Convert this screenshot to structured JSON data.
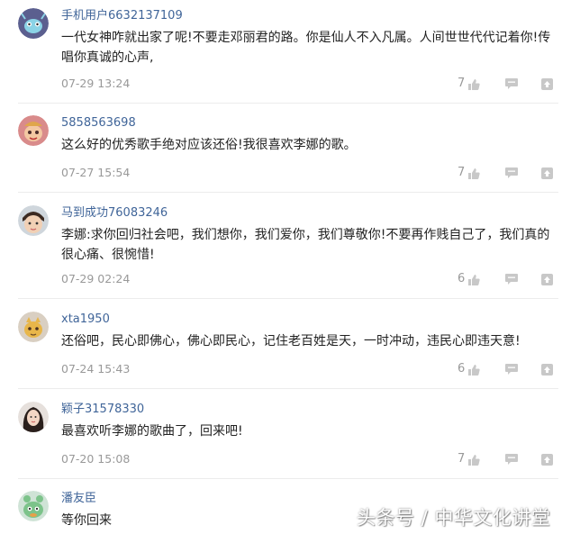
{
  "comments": [
    {
      "user": "手机用户6632137109",
      "text": "一代女神咋就出家了呢!不要走邓丽君的路。你是仙人不入凡属。人间世世代代记着你!传唱你真诚的心声,",
      "date": "07-29 13:24",
      "likes": "7",
      "avatar": "alien-avatar"
    },
    {
      "user": "5858563698",
      "text": "这么好的优秀歌手绝对应该还俗!我很喜欢李娜的歌。",
      "date": "07-27 15:54",
      "likes": "7",
      "avatar": "pink-cartoon-avatar"
    },
    {
      "user": "马到成功76083246",
      "text": "李娜:求你回归社会吧，我们想你，我们爱你，我们尊敬你!不要再作贱自己了，我们真的很心痛、很惋惜!",
      "date": "07-29 02:24",
      "likes": "6",
      "avatar": "baby-photo-avatar"
    },
    {
      "user": "xta1950",
      "text": "还俗吧，民心即佛心，佛心即民心，记住老百姓是天，一时冲动，违民心即违天意!",
      "date": "07-24 15:43",
      "likes": "6",
      "avatar": "yellow-cartoon-avatar"
    },
    {
      "user": "颖子31578330",
      "text": "最喜欢听李娜的歌曲了，回来吧!",
      "date": "07-20 15:08",
      "likes": "7",
      "avatar": "girl-photo-avatar"
    },
    {
      "user": "潘友臣",
      "text": "等你回来",
      "date": "",
      "likes": "",
      "avatar": "green-cartoon-avatar"
    }
  ],
  "watermark": "头条号 / 中华文化讲堂",
  "colors": {
    "username": "#406599",
    "meta": "#999999",
    "text": "#222222"
  }
}
